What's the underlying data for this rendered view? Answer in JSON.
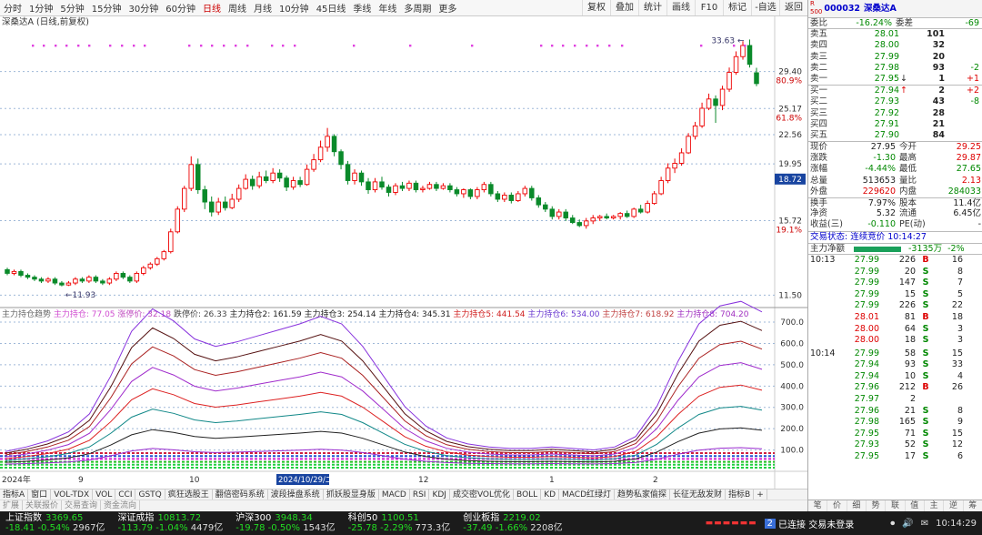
{
  "toolbar": {
    "periods": [
      "分时",
      "1分钟",
      "5分钟",
      "15分钟",
      "30分钟",
      "60分钟",
      "日线",
      "周线",
      "月线",
      "10分钟",
      "45日线",
      "季线",
      "年线",
      "多周期",
      "更多"
    ],
    "selected": "日线",
    "right": [
      "复权",
      "叠加",
      "统计",
      "画线",
      "F10",
      "标记",
      "-自选",
      "返回"
    ]
  },
  "chart_title": "深桑达A (日线,前复权)",
  "tabs1": [
    "指标A",
    "窗口",
    "VOL-TDX",
    "VOL",
    "CCI",
    "GSTQ",
    "疯狂选股王",
    "翻倍密码系统",
    "波段操盘系统",
    "抓妖股显身版",
    "MACD",
    "RSI",
    "KDJ",
    "成交密VOL优化",
    "BOLL",
    "KD",
    "MACD红绿灯",
    "趋势私家偷探",
    "长征无敌发财",
    "指标B",
    "+"
  ],
  "tabs2": [
    "扩展",
    "关联报价",
    "交易查询",
    "资金流向"
  ],
  "rtabs": [
    "笔",
    "价",
    "细",
    "势",
    "联",
    "值",
    "主",
    "逆",
    "筹"
  ],
  "status": {
    "indices": [
      {
        "name": "上证指数",
        "value": "3369.65",
        "chg": "-18.41",
        "pct": "-0.54%",
        "amt": "2967亿"
      },
      {
        "name": "深证成指",
        "value": "10813.72",
        "chg": "-113.79",
        "pct": "-1.04%",
        "amt": "4479亿"
      },
      {
        "name": "沪深300",
        "value": "3948.34",
        "chg": "-19.78",
        "pct": "-0.50%",
        "amt": "1543亿"
      },
      {
        "name": "科创50",
        "value": "1100.51",
        "chg": "-25.78",
        "pct": "-2.29%",
        "amt": "773.3亿"
      },
      {
        "name": "创业板指",
        "value": "2219.02",
        "chg": "-37.49",
        "pct": "-1.66%",
        "amt": "2208亿"
      }
    ],
    "conn": "已连接 交易未登录",
    "time": "10:14:29"
  },
  "side": {
    "code": "000032",
    "name": "深桑达A",
    "weibi_label": "委比",
    "weibi": "-16.24%",
    "weicha_label": "委差",
    "weicha": "-69",
    "asks": [
      {
        "l": "卖五",
        "p": "28.01",
        "v": "101",
        "c": ""
      },
      {
        "l": "卖四",
        "p": "28.00",
        "v": "32",
        "c": ""
      },
      {
        "l": "卖三",
        "p": "27.99",
        "v": "20",
        "c": ""
      },
      {
        "l": "卖二",
        "p": "27.98",
        "v": "93",
        "c": "-2"
      },
      {
        "l": "卖一",
        "p": "27.95",
        "v": "1",
        "c": "+1",
        "arr": "↓"
      }
    ],
    "bids": [
      {
        "l": "买一",
        "p": "27.94",
        "v": "2",
        "c": "+2",
        "arr": "↑"
      },
      {
        "l": "买二",
        "p": "27.93",
        "v": "43",
        "c": "-8"
      },
      {
        "l": "买三",
        "p": "27.92",
        "v": "28",
        "c": ""
      },
      {
        "l": "买四",
        "p": "27.91",
        "v": "21",
        "c": ""
      },
      {
        "l": "买五",
        "p": "27.90",
        "v": "84",
        "c": ""
      }
    ],
    "stats": [
      [
        "现价",
        "27.95",
        "今开",
        "29.25"
      ],
      [
        "涨跌",
        "-1.30",
        "最高",
        "29.87"
      ],
      [
        "涨幅",
        "-4.44%",
        "最低",
        "27.65"
      ],
      [
        "总量",
        "513653",
        "量比",
        "2.13"
      ],
      [
        "外盘",
        "229620",
        "内盘",
        "284033"
      ],
      [
        "换手",
        "7.97%",
        "股本",
        "11.4亿"
      ],
      [
        "净资",
        "5.32",
        "流通",
        "6.45亿"
      ],
      [
        "收益(三)",
        "-0.110",
        "PE(动)",
        "-"
      ]
    ],
    "trade_state": "交易状态: 连续竞价 10:14:27",
    "main_flow_label": "主力净额",
    "main_flow": "-3135万",
    "main_flow_pct": "-2%",
    "ticks_a_time": "10:13",
    "ticks_a": [
      [
        "27.99",
        "226",
        "B",
        "16"
      ],
      [
        "27.99",
        "20",
        "S",
        "8"
      ],
      [
        "27.99",
        "147",
        "S",
        "7"
      ],
      [
        "27.99",
        "15",
        "S",
        "5"
      ],
      [
        "27.99",
        "226",
        "S",
        "22"
      ],
      [
        "28.01",
        "81",
        "B",
        "18"
      ],
      [
        "28.00",
        "64",
        "S",
        "3"
      ],
      [
        "28.00",
        "18",
        "S",
        "3"
      ]
    ],
    "ticks_b_time": "10:14",
    "ticks_b": [
      [
        "27.99",
        "58",
        "S",
        "15"
      ],
      [
        "27.94",
        "93",
        "S",
        "33"
      ],
      [
        "27.94",
        "10",
        "S",
        "4"
      ],
      [
        "27.96",
        "212",
        "B",
        "26"
      ],
      [
        "27.97",
        "2",
        "",
        ""
      ],
      [
        "27.96",
        "21",
        "S",
        "8"
      ],
      [
        "27.98",
        "165",
        "S",
        "9"
      ],
      [
        "27.95",
        "71",
        "S",
        "15"
      ],
      [
        "27.93",
        "52",
        "S",
        "12"
      ],
      [
        "27.95",
        "17",
        "S",
        "6"
      ]
    ]
  },
  "chart_data": [
    {
      "type": "candlestick",
      "title": "深桑达A (日线,前复权)",
      "y_ticks": [
        11.5,
        15.72,
        19.95,
        22.56,
        25.17,
        29.4
      ],
      "pct_labels": {
        "29.40": "80.9%",
        "25.17": "61.8%",
        "15.72": "19.1%"
      },
      "last_price_marker": "18.72",
      "annotations": [
        {
          "label": "33.63",
          "value": 33.63
        },
        {
          "label": "11.93",
          "value": 11.93
        }
      ],
      "x_labels": [
        "2024年",
        "9",
        "10",
        "2024/10/29/二",
        "12",
        "1",
        "2"
      ],
      "candles": [
        [
          12.8,
          12.6,
          12.9,
          12.5
        ],
        [
          12.6,
          12.7,
          12.8,
          12.5
        ],
        [
          12.7,
          12.5,
          12.8,
          12.4
        ],
        [
          12.5,
          12.4,
          12.6,
          12.3
        ],
        [
          12.4,
          12.3,
          12.5,
          12.2
        ],
        [
          12.3,
          12.2,
          12.4,
          12.1
        ],
        [
          12.2,
          12.3,
          12.4,
          12.1
        ],
        [
          12.3,
          12.1,
          12.4,
          12.0
        ],
        [
          12.1,
          12.0,
          12.2,
          11.93
        ],
        [
          12.0,
          12.1,
          12.2,
          11.95
        ],
        [
          12.1,
          12.3,
          12.4,
          12.0
        ],
        [
          12.3,
          12.2,
          12.4,
          12.1
        ],
        [
          12.2,
          12.4,
          12.5,
          12.1
        ],
        [
          12.4,
          12.2,
          12.5,
          12.1
        ],
        [
          12.2,
          12.1,
          12.3,
          12.0
        ],
        [
          12.1,
          12.3,
          12.4,
          12.0
        ],
        [
          12.3,
          12.6,
          12.7,
          12.2
        ],
        [
          12.6,
          12.4,
          12.7,
          12.3
        ],
        [
          12.4,
          12.2,
          12.5,
          12.1
        ],
        [
          12.2,
          12.6,
          12.7,
          12.1
        ],
        [
          12.6,
          12.9,
          13.0,
          12.5
        ],
        [
          12.9,
          13.1,
          13.2,
          12.8
        ],
        [
          13.1,
          13.4,
          13.5,
          13.0
        ],
        [
          13.4,
          13.8,
          13.9,
          13.3
        ],
        [
          13.8,
          15.0,
          15.2,
          13.7
        ],
        [
          15.0,
          16.5,
          16.7,
          14.9
        ],
        [
          16.5,
          18.0,
          18.2,
          16.3
        ],
        [
          18.0,
          19.9,
          20.6,
          17.8
        ],
        [
          19.9,
          17.9,
          20.4,
          17.6
        ],
        [
          17.9,
          17.0,
          18.2,
          16.5
        ],
        [
          17.0,
          16.3,
          17.4,
          16.0
        ],
        [
          16.3,
          17.0,
          17.3,
          16.1
        ],
        [
          17.0,
          16.6,
          17.4,
          16.4
        ],
        [
          16.6,
          17.2,
          17.6,
          16.5
        ],
        [
          17.2,
          18.0,
          18.3,
          17.0
        ],
        [
          18.0,
          18.7,
          19.1,
          17.9
        ],
        [
          18.7,
          18.2,
          19.0,
          17.9
        ],
        [
          18.2,
          18.9,
          19.3,
          18.0
        ],
        [
          18.9,
          18.6,
          19.4,
          18.4
        ],
        [
          18.6,
          19.2,
          19.6,
          18.4
        ],
        [
          19.2,
          18.8,
          19.5,
          18.5
        ],
        [
          18.8,
          18.1,
          19.0,
          17.8
        ],
        [
          18.1,
          18.6,
          18.9,
          17.9
        ],
        [
          18.6,
          18.3,
          18.9,
          18.1
        ],
        [
          18.3,
          19.5,
          19.9,
          18.2
        ],
        [
          19.5,
          20.3,
          20.8,
          19.3
        ],
        [
          20.3,
          21.4,
          22.0,
          20.1
        ],
        [
          21.4,
          22.4,
          23.2,
          21.0
        ],
        [
          22.4,
          21.0,
          22.6,
          20.6
        ],
        [
          21.0,
          19.9,
          21.2,
          19.5
        ],
        [
          19.9,
          18.6,
          20.2,
          18.3
        ],
        [
          18.6,
          19.2,
          19.5,
          18.3
        ],
        [
          19.2,
          18.5,
          19.4,
          18.2
        ],
        [
          18.5,
          17.9,
          18.8,
          17.6
        ],
        [
          17.9,
          18.5,
          18.8,
          17.7
        ],
        [
          18.5,
          18.1,
          18.9,
          17.9
        ],
        [
          18.1,
          17.7,
          18.3,
          17.4
        ],
        [
          17.7,
          18.2,
          18.4,
          17.5
        ],
        [
          18.2,
          18.0,
          18.5,
          17.8
        ],
        [
          18.0,
          18.4,
          18.6,
          17.8
        ],
        [
          18.4,
          17.9,
          18.6,
          17.7
        ],
        [
          17.9,
          18.0,
          18.2,
          17.7
        ],
        [
          18.0,
          18.3,
          18.5,
          17.9
        ],
        [
          18.3,
          18.0,
          18.5,
          17.8
        ],
        [
          18.0,
          18.2,
          18.4,
          17.9
        ],
        [
          18.2,
          17.9,
          18.4,
          17.7
        ],
        [
          17.9,
          17.6,
          18.1,
          17.4
        ],
        [
          17.6,
          17.9,
          18.0,
          17.3
        ],
        [
          17.9,
          17.4,
          18.0,
          17.2
        ],
        [
          17.4,
          17.9,
          18.1,
          17.2
        ],
        [
          17.9,
          18.3,
          18.5,
          17.7
        ],
        [
          18.3,
          17.6,
          18.5,
          17.4
        ],
        [
          17.6,
          17.2,
          17.8,
          17.0
        ],
        [
          17.2,
          17.5,
          17.7,
          17.0
        ],
        [
          17.5,
          17.1,
          17.7,
          16.9
        ],
        [
          17.1,
          17.6,
          17.8,
          17.0
        ],
        [
          17.6,
          18.0,
          18.2,
          17.4
        ],
        [
          18.0,
          17.3,
          18.2,
          17.1
        ],
        [
          17.3,
          16.8,
          17.5,
          16.6
        ],
        [
          16.8,
          16.5,
          17.0,
          16.3
        ],
        [
          16.5,
          16.0,
          16.7,
          15.8
        ],
        [
          16.0,
          16.3,
          16.5,
          15.8
        ],
        [
          16.3,
          15.9,
          16.5,
          15.7
        ],
        [
          15.9,
          15.6,
          16.1,
          15.5
        ],
        [
          15.6,
          15.4,
          15.8,
          15.3
        ],
        [
          15.4,
          15.7,
          15.9,
          15.2
        ],
        [
          15.7,
          15.9,
          16.1,
          15.5
        ],
        [
          15.9,
          16.0,
          16.1,
          15.7
        ],
        [
          16.0,
          15.9,
          16.2,
          15.8
        ],
        [
          15.9,
          16.0,
          16.1,
          15.8
        ],
        [
          16.0,
          16.2,
          16.3,
          15.8
        ],
        [
          16.2,
          16.0,
          16.4,
          15.9
        ],
        [
          16.0,
          16.5,
          16.6,
          15.9
        ],
        [
          16.5,
          16.3,
          16.8,
          16.2
        ],
        [
          16.3,
          16.9,
          17.1,
          16.2
        ],
        [
          16.9,
          17.6,
          17.8,
          16.8
        ],
        [
          17.6,
          18.6,
          18.9,
          17.5
        ],
        [
          18.6,
          19.6,
          20.0,
          18.4
        ],
        [
          19.6,
          20.0,
          20.4,
          19.2
        ],
        [
          20.0,
          20.9,
          21.3,
          19.8
        ],
        [
          20.9,
          22.4,
          22.7,
          20.8
        ],
        [
          22.4,
          23.4,
          23.8,
          22.1
        ],
        [
          23.4,
          25.2,
          25.8,
          23.2
        ],
        [
          25.2,
          26.2,
          26.8,
          25.0
        ],
        [
          26.2,
          25.5,
          26.6,
          23.7
        ],
        [
          25.5,
          27.3,
          27.7,
          25.0
        ],
        [
          27.3,
          29.3,
          29.9,
          27.0
        ],
        [
          29.3,
          31.3,
          32.0,
          29.0
        ],
        [
          31.3,
          32.8,
          33.4,
          30.9
        ],
        [
          32.8,
          30.3,
          33.63,
          29.9
        ],
        [
          29.25,
          27.95,
          29.87,
          27.65
        ]
      ]
    },
    {
      "type": "line",
      "title": "主力持仓趋势",
      "legend": [
        [
          "主力持仓",
          "77.05"
        ],
        [
          "涨停价",
          "32.18"
        ],
        [
          "跌停价",
          "26.33"
        ],
        [
          "主力持仓2",
          "161.59"
        ],
        [
          "主力持仓3",
          "254.14"
        ],
        [
          "主力持仓4",
          "345.31"
        ],
        [
          "主力持仓5",
          "441.54"
        ],
        [
          "主力持仓6",
          "534.00"
        ],
        [
          "主力持仓7",
          "618.92"
        ],
        [
          "主力持仓8",
          "704.20"
        ]
      ],
      "y_ticks": [
        100,
        200,
        300,
        400,
        500,
        600,
        700
      ],
      "ylim": [
        0,
        760
      ]
    }
  ]
}
